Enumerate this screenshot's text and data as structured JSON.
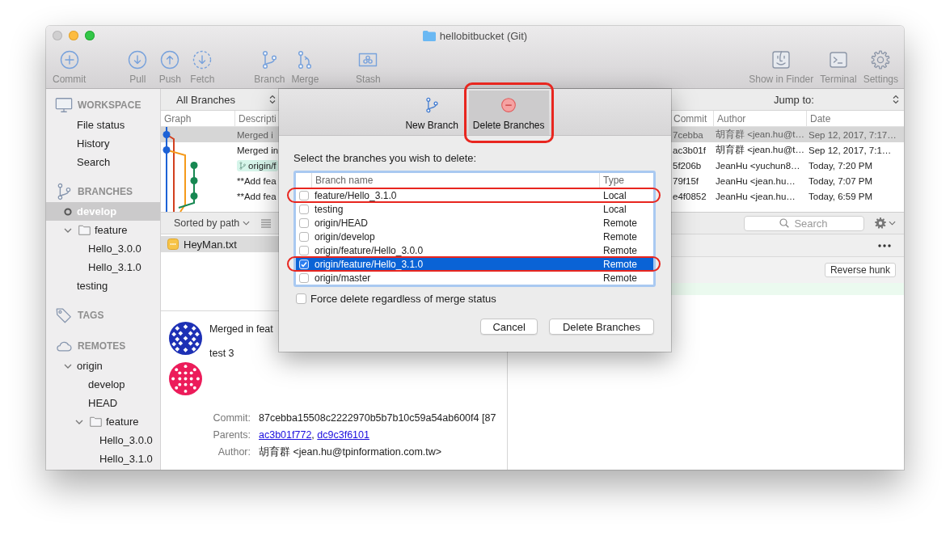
{
  "window": {
    "title": "hellobitbucket (Git)"
  },
  "toolbar": {
    "groups": [
      [
        {
          "kind": "commit",
          "label": "Commit"
        }
      ],
      [
        {
          "kind": "pull",
          "label": "Pull"
        },
        {
          "kind": "push",
          "label": "Push"
        },
        {
          "kind": "fetch",
          "label": "Fetch"
        }
      ],
      [
        {
          "kind": "branch",
          "label": "Branch"
        },
        {
          "kind": "merge",
          "label": "Merge"
        }
      ],
      [
        {
          "kind": "stash",
          "label": "Stash"
        }
      ],
      [
        {
          "kind": "finder",
          "label": "Show in Finder"
        },
        {
          "kind": "terminal",
          "label": "Terminal"
        },
        {
          "kind": "settings",
          "label": "Settings"
        }
      ]
    ]
  },
  "sidebar": {
    "sections": [
      {
        "kind": "workspace",
        "title": "WORKSPACE",
        "items": [
          {
            "kind": "view",
            "label": "File status",
            "selected": false
          },
          {
            "kind": "view",
            "label": "History",
            "selected": false
          },
          {
            "kind": "view",
            "label": "Search",
            "selected": false
          }
        ]
      },
      {
        "kind": "branches",
        "title": "BRANCHES",
        "items": [
          {
            "kind": "branch",
            "label": "develop",
            "selected": true,
            "current": true
          },
          {
            "kind": "folder",
            "label": "feature",
            "selected": false,
            "expanded": true,
            "children": [
              {
                "kind": "branch",
                "label": "Hello_3.0.0",
                "selected": false,
                "current": false
              },
              {
                "kind": "branch",
                "label": "Hello_3.1.0",
                "selected": false,
                "current": false
              }
            ]
          },
          {
            "kind": "branch",
            "label": "testing",
            "selected": false,
            "current": false
          }
        ]
      },
      {
        "kind": "tags",
        "title": "TAGS"
      },
      {
        "kind": "remotes",
        "title": "REMOTES",
        "items": [
          {
            "kind": "remote",
            "label": "origin",
            "selected": false,
            "expanded": true,
            "children": [
              {
                "kind": "branch",
                "label": "develop",
                "selected": false
              },
              {
                "kind": "branch",
                "label": "HEAD",
                "selected": false
              },
              {
                "kind": "folder",
                "label": "feature",
                "selected": false,
                "expanded": true,
                "children": [
                  {
                    "kind": "branch",
                    "label": "Hello_3.0.0",
                    "selected": false
                  },
                  {
                    "kind": "branch",
                    "label": "Hello_3.1.0",
                    "selected": false
                  }
                ]
              }
            ]
          }
        ]
      }
    ]
  },
  "history": {
    "branch_filter": "All Branches",
    "jump_to": "Jump to:",
    "columns": [
      "Graph",
      "Descripti",
      "Commit",
      "Author",
      "Date"
    ],
    "rows": [
      {
        "selected": true,
        "description": "Merged i",
        "commit": "7cebba",
        "author": "胡育群 <jean.hu@t…",
        "date": "Sep 12, 2017, 7:17…"
      },
      {
        "selected": false,
        "description": "Merged in",
        "commit": "ac3b01f",
        "author": "胡育群 <jean.hu@t…",
        "date": "Sep 12, 2017, 7:1…"
      },
      {
        "selected": false,
        "ref": "origin/f",
        "commit": "5f206b",
        "author": "JeanHu <yuchun8…",
        "date": "Today, 7:20 PM"
      },
      {
        "selected": false,
        "description": "**Add fea",
        "commit": "79f15f",
        "author": "JeanHu <jean.hu…",
        "date": "Today, 7:07 PM"
      },
      {
        "selected": false,
        "description": "**Add fea",
        "commit": "e4f0852",
        "author": "JeanHu <jean.hu…",
        "date": "Today, 6:59 PM"
      }
    ]
  },
  "files_toolbar": {
    "sort": "Sorted by path",
    "search": {
      "placeholder": "Search"
    }
  },
  "files": [
    {
      "name": "HeyMan.txt",
      "kind": "modified",
      "selected": true
    }
  ],
  "commit_details": {
    "avatars": [
      {
        "color": "#1d30b5"
      },
      {
        "color": "#ec1c5a"
      }
    ],
    "subject": "Merged in feat",
    "body": "test 3",
    "fields": [
      {
        "kind": "text",
        "label": "Commit:",
        "value": "87cebba15508c2222970b5b7b10c59a54ab600f4 [87"
      },
      {
        "kind": "links",
        "label": "Parents:",
        "links": [
          "ac3b01f772",
          "dc9c3f6101"
        ],
        "separator": ", "
      },
      {
        "kind": "text",
        "label": "Author:",
        "value": "胡育群 <jean.hu@tpinformation.com.tw>"
      }
    ]
  },
  "diff": {
    "hunk_button": "Reverse hunk",
    "lines": [
      {
        "kind": "added"
      }
    ]
  },
  "dialog": {
    "tabs": [
      {
        "kind": "new",
        "label": "New Branch",
        "selected": false,
        "highlighted": false
      },
      {
        "kind": "delete",
        "label": "Delete Branches",
        "selected": true,
        "highlighted": true
      }
    ],
    "prompt": "Select the branches you wish to delete:",
    "columns": [
      "Branch name",
      "Type"
    ],
    "rows": [
      {
        "name": "feature/Hello_3.1.0",
        "type": "Local",
        "checked": false,
        "selected": false,
        "highlighted": true
      },
      {
        "name": "testing",
        "type": "Local",
        "checked": false,
        "selected": false,
        "highlighted": false
      },
      {
        "name": "origin/HEAD",
        "type": "Remote",
        "checked": false,
        "selected": false,
        "highlighted": false
      },
      {
        "name": "origin/develop",
        "type": "Remote",
        "checked": false,
        "selected": false,
        "highlighted": false
      },
      {
        "name": "origin/feature/Hello_3.0.0",
        "type": "Remote",
        "checked": false,
        "selected": false,
        "highlighted": false
      },
      {
        "name": "origin/feature/Hello_3.1.0",
        "type": "Remote",
        "checked": true,
        "selected": true,
        "highlighted": true
      },
      {
        "name": "origin/master",
        "type": "Remote",
        "checked": false,
        "selected": false,
        "highlighted": false
      }
    ],
    "force_delete": {
      "label": "Force delete regardless of merge status",
      "checked": false
    },
    "buttons": [
      "Cancel",
      "Delete Branches"
    ]
  }
}
